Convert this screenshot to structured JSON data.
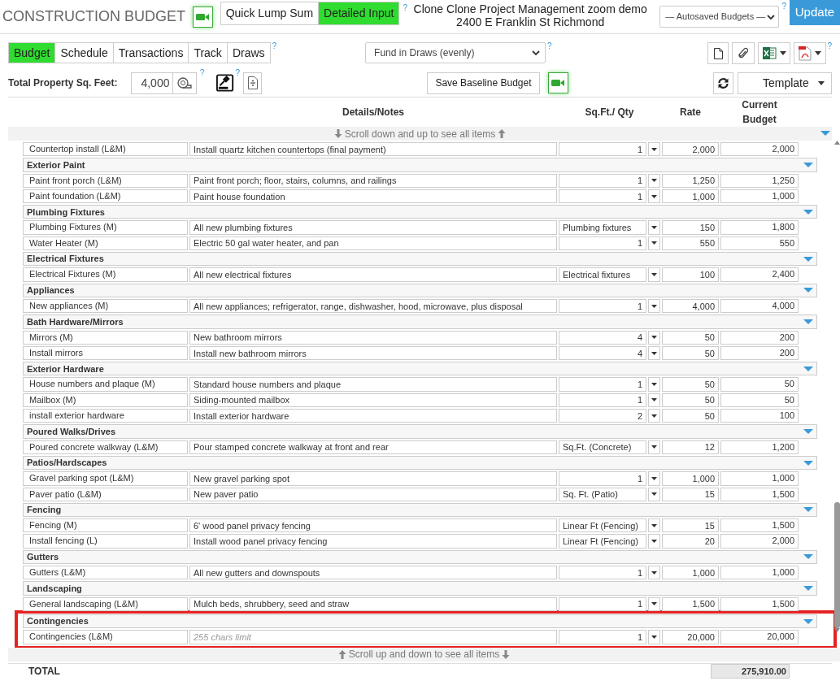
{
  "header": {
    "title": "CONSTRUCTION BUDGET",
    "mode_buttons": [
      {
        "label": "Quick Lump Sum",
        "selected": false
      },
      {
        "label": "Detailed Input",
        "selected": true
      }
    ],
    "mode_help": "?",
    "project_name": "Clone Clone Project Management zoom demo",
    "project_address": "2400 E Franklin St Richmond",
    "autosaved_select": "— Autosaved Budgets —",
    "autosaved_help": "?",
    "update_button": "Update"
  },
  "tabs": [
    {
      "label": "Budget",
      "selected": true
    },
    {
      "label": "Schedule",
      "selected": false
    },
    {
      "label": "Transactions",
      "selected": false
    },
    {
      "label": "Track",
      "selected": false
    },
    {
      "label": "Draws",
      "selected": false
    }
  ],
  "tabs_help": "?",
  "funding_select": "Fund in Draws (evenly)",
  "funding_help": "?",
  "export_help": "?",
  "sqft": {
    "label": "Total Property Sq. Feet:",
    "value": "4,000",
    "measure_help": "?",
    "gavel_help": "?"
  },
  "save_baseline_button": "Save Baseline Budget",
  "template_button": "Template",
  "table": {
    "columns": [
      "Details/Notes",
      "Sq.Ft./ Qty",
      "Rate",
      "Current Budget"
    ],
    "scroll_hint_top": "Scroll down and up to see all items",
    "groups": [
      {
        "highlighted": false,
        "items": [
          {
            "name": "Countertop install (L&M)",
            "details": "Install quartz kitchen countertops (final payment)",
            "qty": "1",
            "kind": "count",
            "rate": "2,000",
            "budget": "2,000"
          }
        ]
      },
      {
        "name": "Exterior Paint",
        "highlighted": false,
        "items": [
          {
            "name": "Paint front porch (L&M)",
            "details": "Paint front porch; floor, stairs, columns, and railings",
            "qty": "1",
            "kind": "count",
            "rate": "1,250",
            "budget": "1,250"
          },
          {
            "name": "Paint foundation (L&M)",
            "details": "Paint house foundation",
            "qty": "1",
            "kind": "count",
            "rate": "1,000",
            "budget": "1,000"
          }
        ]
      },
      {
        "name": "Plumbing Fixtures",
        "highlighted": false,
        "items": [
          {
            "name": "Plumbing Fixtures (M)",
            "details": "All new plumbing fixtures",
            "qty": "Plumbing fixtures",
            "kind": "unit",
            "rate": "150",
            "budget": "1,800"
          },
          {
            "name": "Water Heater (M)",
            "details": "Electric 50 gal water heater, and pan",
            "qty": "1",
            "kind": "count",
            "rate": "550",
            "budget": "550"
          }
        ]
      },
      {
        "name": "Electrical Fixtures",
        "highlighted": false,
        "items": [
          {
            "name": "Electrical Fixtures (M)",
            "details": "All new electrical fixtures",
            "qty": "Electrical fixtures",
            "kind": "unit",
            "rate": "100",
            "budget": "2,400"
          }
        ]
      },
      {
        "name": "Appliances",
        "highlighted": false,
        "items": [
          {
            "name": "New appliances (M)",
            "details": "All new appliances; refrigerator, range, dishwasher, hood, microwave, plus disposal",
            "qty": "1",
            "kind": "count",
            "rate": "4,000",
            "budget": "4,000"
          }
        ]
      },
      {
        "name": "Bath Hardware/Mirrors",
        "highlighted": false,
        "items": [
          {
            "name": "Mirrors (M)",
            "details": "New bathroom mirrors",
            "qty": "4",
            "kind": "count",
            "rate": "50",
            "budget": "200"
          },
          {
            "name": "Install mirrors",
            "details": "Install new bathroom mirrors",
            "qty": "4",
            "kind": "count",
            "rate": "50",
            "budget": "200"
          }
        ]
      },
      {
        "name": "Exterior Hardware",
        "highlighted": false,
        "items": [
          {
            "name": "House numbers and plaque (M)",
            "details": "Standard house numbers and plaque",
            "qty": "1",
            "kind": "count",
            "rate": "50",
            "budget": "50"
          },
          {
            "name": "Mailbox (M)",
            "details": "Siding-mounted mailbox",
            "qty": "1",
            "kind": "count",
            "rate": "50",
            "budget": "50"
          },
          {
            "name": "install exterior hardware",
            "details": "Install exterior hardware",
            "qty": "2",
            "kind": "count",
            "rate": "50",
            "budget": "100"
          }
        ]
      },
      {
        "name": "Poured Walks/Drives",
        "highlighted": false,
        "items": [
          {
            "name": "Poured concrete walkway (L&M)",
            "details": "Pour stamped concrete walkway at front and rear",
            "qty": "Sq.Ft. (Concrete)",
            "kind": "unit",
            "rate": "12",
            "budget": "1,200"
          }
        ]
      },
      {
        "name": "Patios/Hardscapes",
        "highlighted": false,
        "items": [
          {
            "name": "Gravel parking spot (L&M)",
            "details": "New gravel parking spot",
            "qty": "1",
            "kind": "count",
            "rate": "1,000",
            "budget": "1,000"
          },
          {
            "name": "Paver patio (L&M)",
            "details": "New paver patio",
            "qty": "Sq. Ft. (Patio)",
            "kind": "unit",
            "rate": "15",
            "budget": "1,500"
          }
        ]
      },
      {
        "name": "Fencing",
        "highlighted": false,
        "items": [
          {
            "name": "Fencing (M)",
            "details": "6' wood panel privacy fencing",
            "qty": "Linear Ft (Fencing)",
            "kind": "unit",
            "rate": "15",
            "budget": "1,500"
          },
          {
            "name": "Install fencing (L)",
            "details": "Install wood panel privacy fencing",
            "qty": "Linear Ft (Fencing)",
            "kind": "unit",
            "rate": "20",
            "budget": "2,000"
          }
        ]
      },
      {
        "name": "Gutters",
        "highlighted": false,
        "items": [
          {
            "name": "Gutters (L&M)",
            "details": "All new gutters and downspouts",
            "qty": "1",
            "kind": "count",
            "rate": "1,000",
            "budget": "1,000"
          }
        ]
      },
      {
        "name": "Landscaping",
        "highlighted": false,
        "items": [
          {
            "name": "General landscaping (L&M)",
            "details": "Mulch beds, shrubbery, seed and straw",
            "qty": "1",
            "kind": "count",
            "rate": "1,500",
            "budget": "1,500"
          }
        ]
      },
      {
        "name": "Contingencies",
        "highlighted": true,
        "items": [
          {
            "name": "Contingencies (L&M)",
            "placeholder": "255 chars limit",
            "qty": "1",
            "kind": "count",
            "rate": "20,000",
            "budget": "20,000"
          }
        ]
      }
    ],
    "scroll_hint_bottom": "Scroll up and down to see all items"
  },
  "total": {
    "label": "TOTAL",
    "value": "275,910.00"
  }
}
